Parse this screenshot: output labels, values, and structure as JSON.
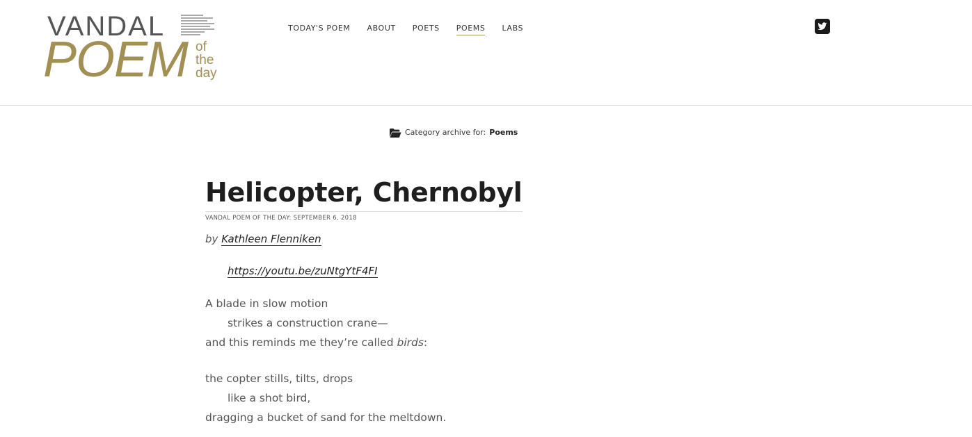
{
  "logo": {
    "line1": "VANDAL",
    "line2": "POEM",
    "of": "of",
    "the": "the",
    "day": "day"
  },
  "nav": {
    "items": [
      {
        "label": "TODAY'S POEM"
      },
      {
        "label": "ABOUT"
      },
      {
        "label": "POETS"
      },
      {
        "label": "POEMS",
        "active": true
      },
      {
        "label": "LABS"
      }
    ]
  },
  "social": {
    "icon": "twitter-icon"
  },
  "archive": {
    "prefix": "Category archive for:",
    "category": "Poems",
    "icon": "folder-open-icon"
  },
  "post": {
    "title": "Helicopter, Chernobyl",
    "meta": "VANDAL POEM OF THE DAY: SEPTEMBER 6, 2018",
    "by": "by",
    "author": "Kathleen Flenniken",
    "video_link": "https://youtu.be/zuNtgYtF4FI",
    "stanza1": {
      "line1": "A blade in slow motion",
      "line2": "strikes a construction crane—",
      "line3_pre": "and this reminds me they’re called",
      "line3_em": "birds",
      "line3_post": ":"
    },
    "stanza2": {
      "line1": "the copter stills, tilts, drops",
      "line2": "like a shot bird,",
      "line3": "dragging a bucket of sand for the meltdown."
    }
  },
  "colors": {
    "accent": "#a18f54",
    "text": "#4a4a4a",
    "heading": "#1e1e1e"
  }
}
